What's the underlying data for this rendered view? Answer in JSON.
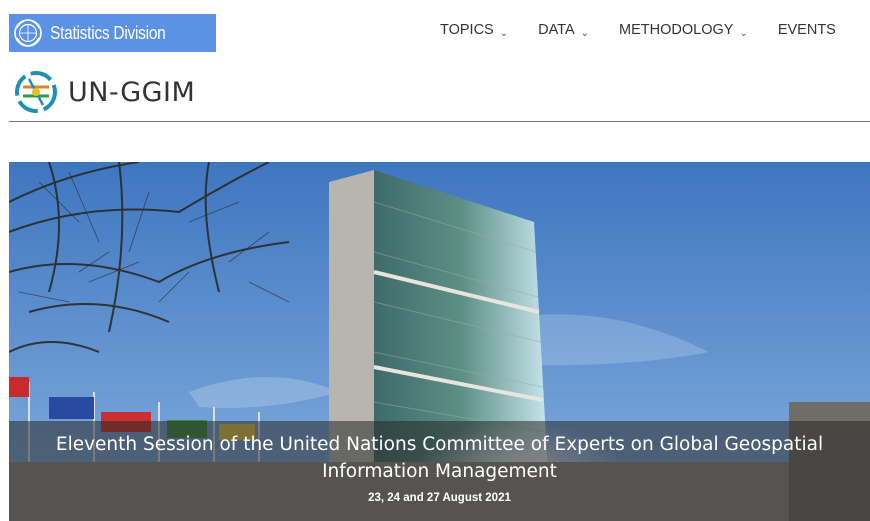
{
  "header": {
    "division_label": "Statistics Division",
    "nav": [
      {
        "label": "TOPICS",
        "caret": "⌄"
      },
      {
        "label": "DATA",
        "caret": "⌄"
      },
      {
        "label": "METHODOLOGY",
        "caret": "⌄"
      },
      {
        "label": "EVENTS"
      }
    ]
  },
  "brand": {
    "name": "UN-GGIM"
  },
  "hero": {
    "title": "Eleventh Session of the United Nations Committee of Experts on Global Geospatial Information Management",
    "date": "23, 24 and 27 August 2021"
  },
  "colors": {
    "badge": "#5b92e5",
    "rule": "#777777",
    "sky": "#4a7fc4"
  }
}
